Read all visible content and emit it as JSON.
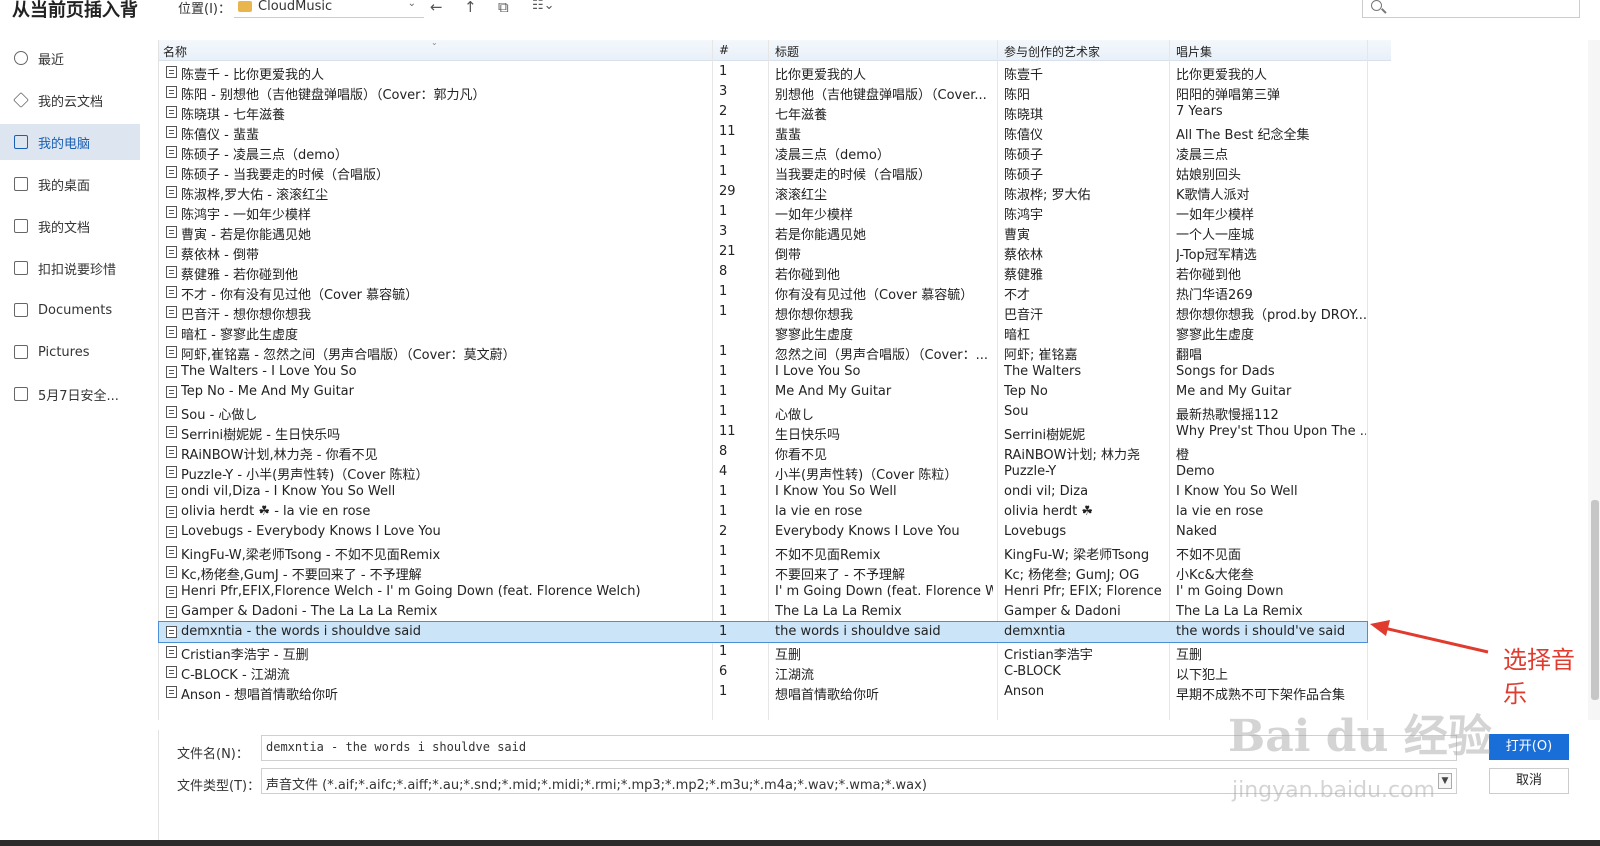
{
  "window": {
    "title": "从当前页插入背"
  },
  "toolbar": {
    "location_label": "位置(I)：",
    "location_value": "CloudMusic",
    "back_icon": "arrow-left-icon",
    "up_icon": "arrow-up-icon",
    "new_folder_icon": "new-folder-icon",
    "view_icon": "view-menu-icon",
    "search_placeholder": ""
  },
  "sidebar": {
    "items": [
      {
        "label": "最近",
        "icon": "clock-icon",
        "active": false
      },
      {
        "label": "我的云文档",
        "icon": "cube-icon",
        "active": false
      },
      {
        "label": "我的电脑",
        "icon": "monitor-icon",
        "active": true
      },
      {
        "label": "我的桌面",
        "icon": "desktop-icon",
        "active": false
      },
      {
        "label": "我的文档",
        "icon": "folder-icon",
        "active": false
      },
      {
        "label": "扣扣说要珍惜",
        "icon": "folder-icon",
        "active": false
      },
      {
        "label": "Documents",
        "icon": "folder-icon",
        "active": false
      },
      {
        "label": "Pictures",
        "icon": "folder-icon",
        "active": false
      },
      {
        "label": "5月7日安全...",
        "icon": "folder-icon",
        "active": false
      }
    ]
  },
  "table": {
    "columns": [
      "名称",
      "#",
      "标题",
      "参与创作的艺术家",
      "唱片集"
    ],
    "rows": [
      [
        "陈壹千 - 比你更爱我的人",
        "1",
        "比你更爱我的人",
        "陈壹千",
        "比你更爱我的人"
      ],
      [
        "陈阳 - 别想他（吉他键盘弹唱版）（Cover：郭力凡）",
        "3",
        "别想他（吉他键盘弹唱版）（Cover...",
        "陈阳",
        "阳阳的弹唱第三弹"
      ],
      [
        "陈晓琪 - 七年滋養",
        "2",
        "七年滋養",
        "陈晓琪",
        "7 Years"
      ],
      [
        "陈僖仪 - 蜚蜚",
        "11",
        "蜚蜚",
        "陈僖仪",
        "All The Best 纪念全集"
      ],
      [
        "陈硕子 - 凌晨三点（demo）",
        "1",
        "凌晨三点（demo）",
        "陈硕子",
        "凌晨三点"
      ],
      [
        "陈硕子 - 当我要走的时候（合唱版）",
        "1",
        "当我要走的时候（合唱版）",
        "陈硕子",
        "姑娘别回头"
      ],
      [
        "陈淑桦,罗大佑 - 滚滚红尘",
        "29",
        "滚滚红尘",
        "陈淑桦; 罗大佑",
        "K歌情人派对"
      ],
      [
        "陈鸿宇 - 一如年少模样",
        "1",
        "一如年少模样",
        "陈鸿宇",
        "一如年少模样"
      ],
      [
        "曹寅 - 若是你能遇见她",
        "3",
        "若是你能遇见她",
        "曹寅",
        "一个人一座城"
      ],
      [
        "蔡依林 - 倒带",
        "21",
        "倒带",
        "蔡依林",
        "J-Top冠军精选"
      ],
      [
        "蔡健雅 - 若你碰到他",
        "8",
        "若你碰到他",
        "蔡健雅",
        "若你碰到他"
      ],
      [
        "不才 - 你有没有见过他（Cover 慕容毓）",
        "1",
        "你有没有见过他（Cover 慕容毓）",
        "不才",
        "热门华语269"
      ],
      [
        "巴音汗 - 想你想你想我",
        "1",
        "想你想你想我",
        "巴音汗",
        "想你想你想我（prod.by DROY..."
      ],
      [
        "暗杠 - 寥寥此生虚度",
        "",
        "寥寥此生虚度",
        "暗杠",
        "寥寥此生虚度"
      ],
      [
        "阿虾,崔铭嘉 - 忽然之间（男声合唱版）（Cover：莫文蔚）",
        "1",
        "忽然之间（男声合唱版）（Cover：...",
        "阿虾; 崔铭嘉",
        "翻唱"
      ],
      [
        "The Walters - I Love You So",
        "1",
        "I Love You So",
        "The Walters",
        "Songs for Dads"
      ],
      [
        "Tep No - Me And My Guitar",
        "1",
        "Me And My Guitar",
        "Tep No",
        "Me and My Guitar"
      ],
      [
        "Sou - 心做し",
        "1",
        "心做し",
        "Sou",
        "最新热歌慢摇112"
      ],
      [
        "Serrini樹妮妮 - 生日快乐吗",
        "11",
        "生日快乐吗",
        "Serrini樹妮妮",
        "Why Prey'st Thou Upon The ..."
      ],
      [
        "RAiNBOW计划,林力尧 - 你看不见",
        "8",
        "你看不见",
        "RAiNBOW计划; 林力尧",
        "橙"
      ],
      [
        "Puzzle-Y - 小半(男声性转)（Cover 陈粒）",
        "4",
        "小半(男声性转)（Cover 陈粒）",
        "Puzzle-Y",
        "Demo"
      ],
      [
        "ondi vil,Diza - I Know You So Well",
        "1",
        "I Know You So Well",
        "ondi vil; Diza",
        "I Know You So Well"
      ],
      [
        "olivia herdt ☘ - la vie en rose",
        "1",
        "la vie en rose",
        "olivia herdt ☘",
        "la vie en rose"
      ],
      [
        "Lovebugs - Everybody Knows I Love You",
        "2",
        "Everybody Knows I Love You",
        "Lovebugs",
        "Naked"
      ],
      [
        "KingFu-W,梁老师Tsong - 不如不见面Remix",
        "1",
        "不如不见面Remix",
        "KingFu-W; 梁老师Tsong",
        "不如不见面"
      ],
      [
        "Kc,杨佬叁,GumJ - 不要回来了 - 不予理解",
        "1",
        "不要回来了 - 不予理解",
        "Kc; 杨佬叁; GumJ; OG",
        "小Kc&大佬叁"
      ],
      [
        "Henri Pfr,EFIX,Florence Welch - I' m Going Down (feat. Florence Welch)",
        "1",
        "I' m Going Down (feat. Florence W...",
        "Henri Pfr; EFIX; Florence ...",
        "I' m Going Down"
      ],
      [
        "Gamper & Dadoni - The La La La Remix",
        "1",
        "The La La La Remix",
        "Gamper & Dadoni",
        "The La La La Remix"
      ],
      [
        "demxntia - the words i shouldve said",
        "1",
        "the words i shouldve said",
        "demxntia",
        "the words i should've said"
      ],
      [
        "Cristian李浩宇 - 互删",
        "1",
        "互删",
        "Cristian李浩宇",
        "互删"
      ],
      [
        "C-BLOCK - 江湖流",
        "6",
        "江湖流",
        "C-BLOCK",
        "以下犯上"
      ],
      [
        "Anson - 想唱首情歌给你听",
        "1",
        "想唱首情歌给你听",
        "Anson",
        "早期不成熟不可下架作品合集"
      ]
    ],
    "selected_index": 28
  },
  "bottom": {
    "filename_label": "文件名(N)：",
    "filename_value": "demxntia - the words i shouldve said",
    "filetype_label": "文件类型(T)：",
    "filetype_value": "声音文件 (*.aif;*.aifc;*.aiff;*.au;*.snd;*.mid;*.midi;*.rmi;*.mp3;*.mp2;*.m3u;*.m4a;*.wav;*.wma;*.wax)",
    "open_label": "打开(O)",
    "cancel_label": "取消"
  },
  "annotation": {
    "text": "选择音乐",
    "color": "#e03b2e"
  },
  "watermark": {
    "logo_text": "Bai du 经验",
    "url_text": "jingyan.baidu.com"
  }
}
